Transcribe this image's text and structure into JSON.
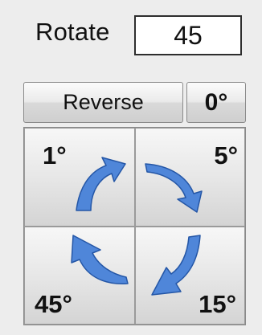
{
  "rotate": {
    "label": "Rotate",
    "value": "45"
  },
  "buttons": {
    "reverse_label": "Reverse",
    "zero_label": "0°"
  },
  "steps": [
    {
      "label": "1°",
      "icon": "rotate-counterclockwise-arrow-icon"
    },
    {
      "label": "5°",
      "icon": "rotate-clockwise-arrow-icon"
    },
    {
      "label": "45°",
      "icon": "rotate-counterclockwise-arrow-icon"
    },
    {
      "label": "15°",
      "icon": "rotate-clockwise-arrow-icon"
    }
  ],
  "colors": {
    "arrow_fill": "#4f86d9",
    "arrow_stroke": "#2456a6"
  }
}
